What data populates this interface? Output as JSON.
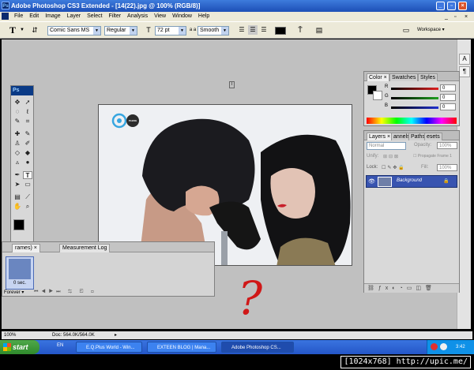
{
  "window": {
    "title": "Adobe Photoshop CS3 Extended - [14(22).jpg @ 100% (RGB/8)]"
  },
  "menu": [
    "File",
    "Edit",
    "Image",
    "Layer",
    "Select",
    "Filter",
    "Analysis",
    "View",
    "Window",
    "Help"
  ],
  "options": {
    "font_family": "Comic Sans MS",
    "font_style": "Regular",
    "font_size": "72 pt",
    "aa_label": "a a",
    "antialias": "Smooth",
    "workspace_label": "Workspace"
  },
  "toolbox": {
    "header": "Ps"
  },
  "canvas": {
    "logo_text": "PLENG",
    "annotation": "?"
  },
  "animation_panel": {
    "tab_animation": "Animation (Frames)",
    "tab_animation_visible": "rames)",
    "tab_measurement": "Measurement Log",
    "frame_delay": "0 sec.",
    "loop": "Forever"
  },
  "color_panel": {
    "tabs": [
      "Color",
      "Swatches",
      "Styles"
    ],
    "channels": [
      {
        "label": "R",
        "value": "0",
        "color": "#e02020"
      },
      {
        "label": "G",
        "value": "0",
        "color": "#20a020"
      },
      {
        "label": "B",
        "value": "0",
        "color": "#2030d0"
      }
    ]
  },
  "layers_panel": {
    "tabs": [
      "Layers",
      "annels",
      "Paths",
      "esets"
    ],
    "blend_mode": "Normal",
    "opacity_label": "Opacity:",
    "opacity": "100%",
    "unify_label": "Unify:",
    "propagate_label": "Propagate Frame 1",
    "lock_label": "Lock:",
    "fill_label": "Fill:",
    "fill": "100%",
    "layers": [
      {
        "name": "Background",
        "selected": true
      }
    ]
  },
  "status": {
    "zoom": "100%",
    "doc": "Doc: 564.0K/564.0K"
  },
  "taskbar": {
    "start": "start",
    "lang": "EN",
    "tasks": [
      {
        "label": "E.Q.Plus World - Win...",
        "active": false
      },
      {
        "label": "EXTEEN BLOG | Mana...",
        "active": false
      },
      {
        "label": "Adobe Photoshop CS...",
        "active": true
      }
    ],
    "clock": "3:42"
  },
  "watermark": "[1024x768] http://upic.me/"
}
